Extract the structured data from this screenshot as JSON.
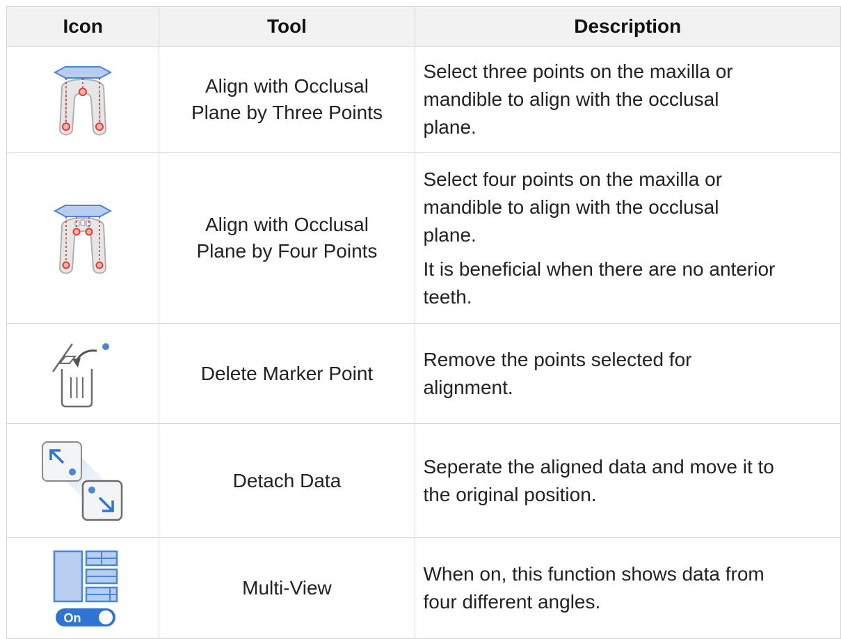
{
  "header": {
    "icon": "Icon",
    "tool": "Tool",
    "description": "Description"
  },
  "rows": [
    {
      "icon": "align-three-points-icon",
      "tool": [
        "Align with Occlusal",
        "Plane by Three Points"
      ],
      "description": [
        [
          "Select three points on the maxilla or",
          "mandible to align with the occlusal",
          "plane."
        ]
      ]
    },
    {
      "icon": "align-four-points-icon",
      "tool": [
        "Align with Occlusal",
        "Plane by Four Points"
      ],
      "description": [
        [
          "Select four points on the maxilla or",
          "mandible to align with the occlusal",
          "plane."
        ],
        [
          "It is beneficial when there are no anterior",
          "teeth."
        ]
      ]
    },
    {
      "icon": "delete-marker-point-icon",
      "tool": [
        "Delete Marker Point"
      ],
      "description": [
        [
          "Remove the points selected for",
          "alignment."
        ]
      ]
    },
    {
      "icon": "detach-data-icon",
      "tool": [
        "Detach Data"
      ],
      "description": [
        [
          "Seperate the aligned data and move it to",
          "the original position."
        ]
      ]
    },
    {
      "icon": "multi-view-icon",
      "icon_text": "On",
      "tool": [
        "Multi-View"
      ],
      "description": [
        [
          "When on, this function shows data from",
          "four different angles."
        ]
      ]
    }
  ],
  "colors": {
    "plane_fill": "#b9cdf0",
    "plane_stroke": "#4a86d4",
    "point_red": "#e23a2e",
    "accent_blue": "#2f74d0",
    "gray_stroke": "#6b6b6b"
  }
}
